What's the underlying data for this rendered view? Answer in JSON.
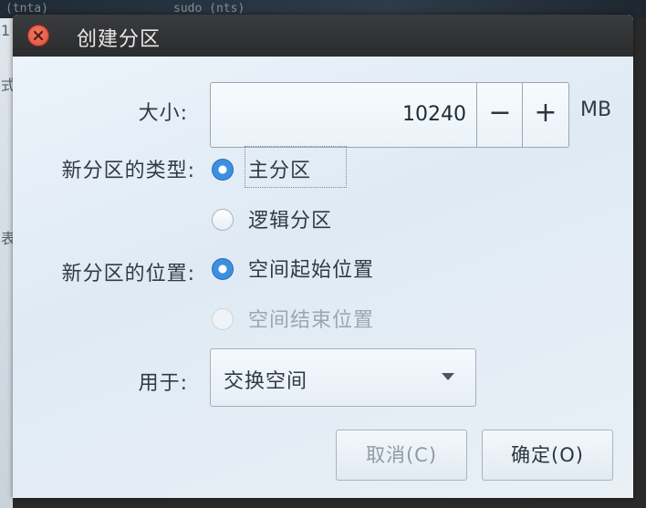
{
  "window": {
    "title": "创建分区"
  },
  "background": {
    "text_left": "(tnta)",
    "text_right": "sudo (nts)",
    "edge_chars": [
      "1",
      "式",
      "表"
    ]
  },
  "form": {
    "size_label": "大小:",
    "size_value": "10240",
    "minus_label": "−",
    "plus_label": "+",
    "unit": "MB",
    "type_label": "新分区的类型:",
    "type_options": [
      {
        "label": "主分区",
        "selected": true,
        "enabled": true
      },
      {
        "label": "逻辑分区",
        "selected": false,
        "enabled": true
      }
    ],
    "location_label": "新分区的位置:",
    "location_options": [
      {
        "label": "空间起始位置",
        "selected": true,
        "enabled": true
      },
      {
        "label": "空间结束位置",
        "selected": false,
        "enabled": false
      }
    ],
    "use_label": "用于:",
    "use_value": "交换空间"
  },
  "buttons": {
    "cancel": "取消(C)",
    "ok": "确定(O)"
  },
  "colors": {
    "accent": "#3d8fe0",
    "titlebar": "#2b2c2e",
    "close": "#dd4c3a"
  }
}
